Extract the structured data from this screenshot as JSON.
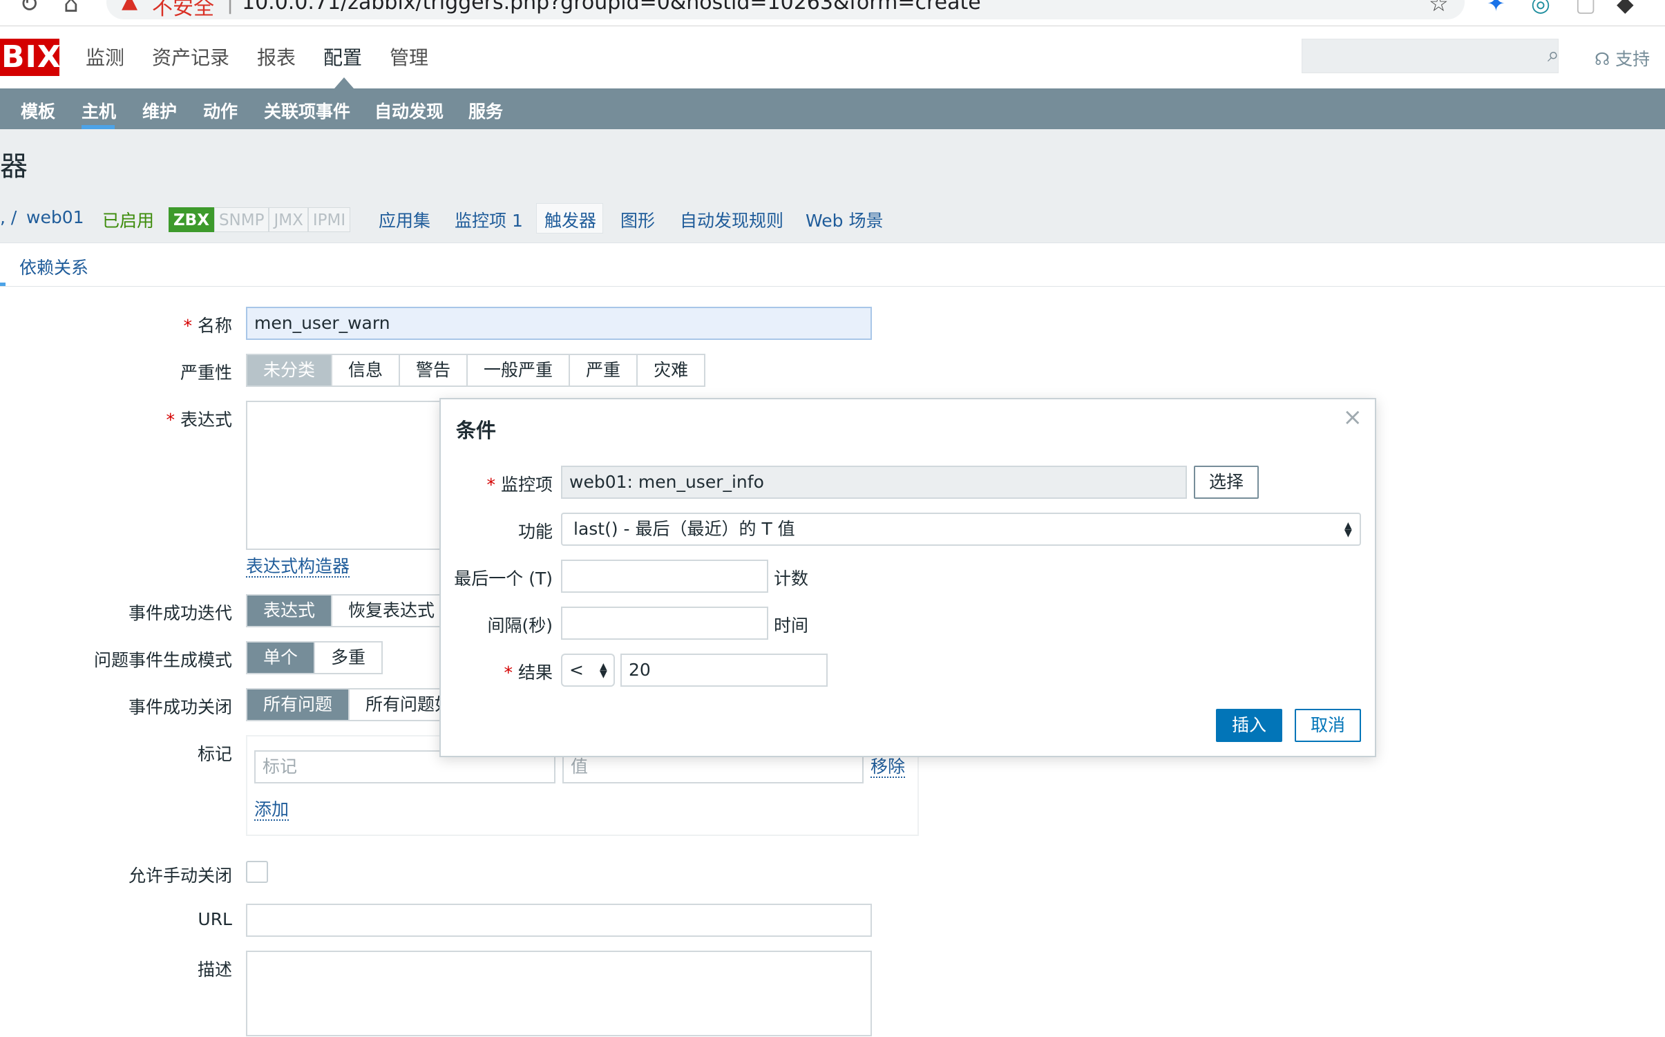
{
  "browser": {
    "security_label": "不安全",
    "separator": "|",
    "url": "10.0.0.71/zabbix/triggers.php?groupid=0&hostid=10263&form=create"
  },
  "header": {
    "logo": "BIX",
    "menu": [
      "监测",
      "资产记录",
      "报表",
      "配置",
      "管理"
    ],
    "support": "支持"
  },
  "subnav": [
    "模板",
    "主机",
    "维护",
    "动作",
    "关联项事件",
    "自动发现",
    "服务"
  ],
  "page": {
    "heading": "器"
  },
  "breadcrumb": {
    "prefix": ", /",
    "host": "web01",
    "status": "已启用",
    "availability": [
      "ZBX",
      "SNMP",
      "JMX",
      "IPMI"
    ],
    "tabs": [
      "应用集",
      "监控项 1",
      "触发器",
      "图形",
      "自动发现规则",
      "Web 场景"
    ]
  },
  "form": {
    "tab_dependency": "依赖关系",
    "required_mark": "*",
    "name_label": "名称",
    "name_value": "men_user_warn",
    "severity_label": "严重性",
    "severity_options": [
      "未分类",
      "信息",
      "警告",
      "一般严重",
      "严重",
      "灾难"
    ],
    "expression_label": "表达式",
    "expression_builder": "表达式构造器",
    "ok_event_label": "事件成功迭代",
    "ok_event_options": [
      "表达式",
      "恢复表达式"
    ],
    "problem_mode_label": "问题事件生成模式",
    "problem_mode_options": [
      "单个",
      "多重"
    ],
    "ok_close_label": "事件成功关闭",
    "ok_close_options": [
      "所有问题",
      "所有问题如"
    ],
    "tags_label": "标记",
    "tag_placeholder": "标记",
    "value_placeholder": "值",
    "remove": "移除",
    "add": "添加",
    "manual_close_label": "允许手动关闭",
    "url_label": "URL",
    "description_label": "描述"
  },
  "modal": {
    "title": "条件",
    "close": "×",
    "item_label": "监控项",
    "item_value": "web01: men_user_info",
    "select_button": "选择",
    "function_label": "功能",
    "function_value": "last() - 最后（最近）的 T 值",
    "last_label": "最后一个 (T)",
    "last_unit": "计数",
    "interval_label": "间隔(秒)",
    "interval_unit": "时间",
    "result_label": "结果",
    "operator": "<",
    "result_value": "20",
    "insert_button": "插入",
    "cancel_button": "取消"
  }
}
